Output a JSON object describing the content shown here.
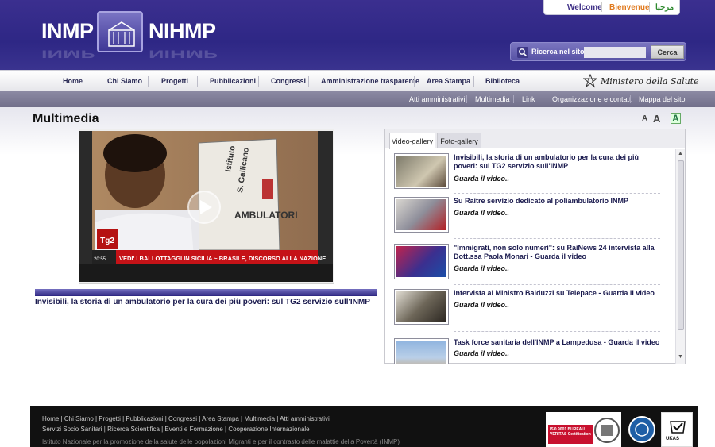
{
  "header": {
    "logo_left": "INMP",
    "logo_right": "NIHMP",
    "lang": {
      "welcome": "Welcome",
      "bienvenue": "Bienvenue",
      "arabic": "مرحبا"
    },
    "search": {
      "label": "Ricerca nel sito:",
      "value": "",
      "button": "Cerca"
    }
  },
  "mainnav": {
    "items": [
      "Home",
      "Chi Siamo",
      "Progetti",
      "Pubblicazioni",
      "Congressi",
      "Amministrazione trasparente",
      "Area Stampa",
      "Biblioteca"
    ],
    "ministero": "Ministero della Salute"
  },
  "subnav": {
    "items": [
      "Atti amministrativi",
      "Multimedia",
      "Link",
      "Organizzazione e contatti",
      "Mappa del sito"
    ]
  },
  "page": {
    "title": "Multimedia",
    "font_tools": {
      "decrease": "A",
      "increase": "A",
      "contrast": "A"
    }
  },
  "video": {
    "ticker": "VEDI' I BALLOTTAGGI IN SICILIA ~ BRASILE, DISCORSO ALLA NAZIONE",
    "time": "20:55",
    "channel": "Tg2",
    "sign_line1": "Istituto",
    "sign_line2": "S. Gallicano",
    "sign_line3": "AMBULATORI",
    "caption": "Invisibili, la storia di un ambulatorio per la cura dei più poveri: sul TG2 servizio sull'INMP"
  },
  "gallery": {
    "tabs": [
      "Video-gallery",
      "Foto-gallery"
    ],
    "items": [
      {
        "title": "Invisibili, la storia di un ambulatorio per la cura dei più poveri: sul TG2 servizio sull'INMP",
        "link": "Guarda il video.."
      },
      {
        "title": "Su Raitre servizio dedicato al poliambulatorio INMP",
        "link": "Guarda il video.."
      },
      {
        "title": "\"Immigrati, non solo numeri\": su RaiNews 24 intervista alla Dott.ssa Paola Monari - Guarda il video",
        "link": "Guarda il video.."
      },
      {
        "title": "Intervista al Ministro Balduzzi su Telepace - Guarda il video",
        "link": "Guarda il video.."
      },
      {
        "title": "Task force sanitaria dell'INMP a Lampedusa - Guarda il video",
        "link": "Guarda il video.."
      }
    ]
  },
  "footer": {
    "links1": "Home  |  Chi Siamo  |  Progetti  |  Pubblicazioni  |  Congressi  |  Area Stampa  |  Multimedia  |  Atti amministrativi",
    "links2": "Servizi Socio Sanitari  |  Ricerca Scientifica  |  Eventi e Formazione  |  Cooperazione Internazionale",
    "description": "Istituto Nazionale per la promozione della salute delle popolazioni Migranti e per il contrasto delle malattie della Povertà (INMP)",
    "cert_bv": "ISO 9001 BUREAU VERITAS Certification",
    "cert_ukas": "UKAS"
  },
  "colors": {
    "header": "#2e2785",
    "accent_orange": "#e07a1f",
    "nav_text": "#2a2a55",
    "subnav": "#7f7d98"
  }
}
